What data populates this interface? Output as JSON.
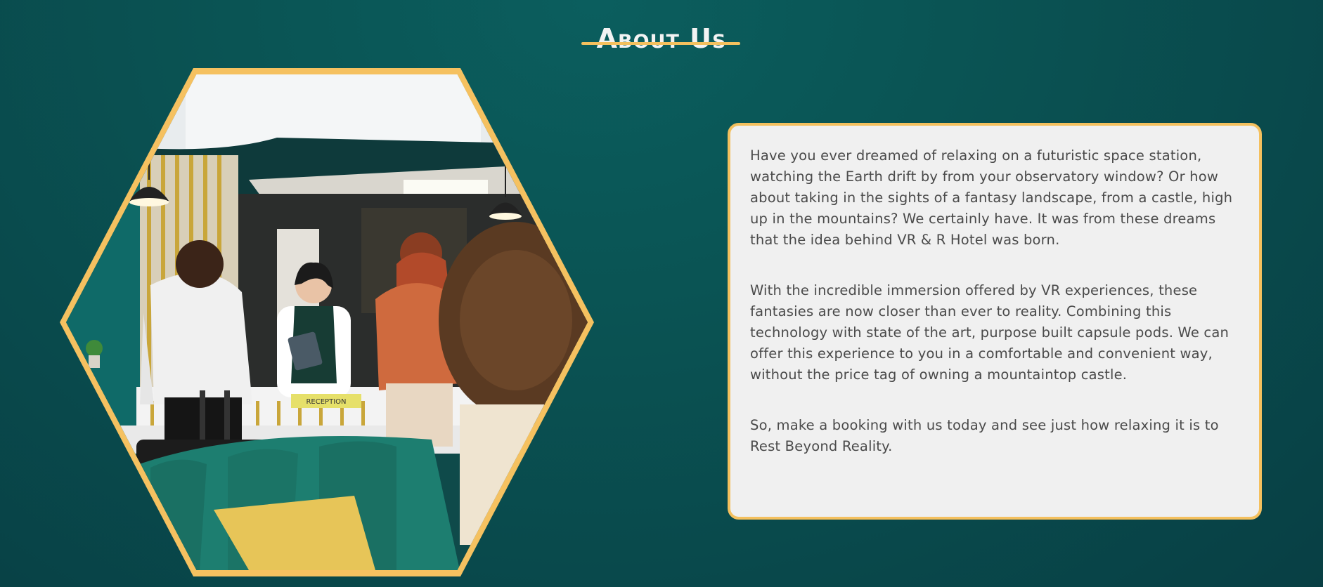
{
  "section": {
    "title": "About Us"
  },
  "image": {
    "alt": "Hotel reception scene",
    "sign_text": "RECEPTION"
  },
  "about": {
    "paragraphs": [
      "Have you ever dreamed of relaxing on a futuristic space station, watching the Earth drift by from your observatory window? Or how about taking in the sights of a fantasy landscape, from a castle, high up in the mountains? We certainly have. It was from these dreams that the idea behind VR & R Hotel was born.",
      "With the incredible immersion offered by VR experiences, these fantasies are now closer than ever to reality. Combining this technology with state of the art, purpose built capsule pods. We can offer this experience to you in a comfortable and convenient way, without the price tag of owning a mountaintop castle.",
      "So, make a booking with us today and see just how relaxing it is to Rest Beyond Reality."
    ]
  },
  "colors": {
    "background": "#0a5454",
    "accent": "#f4c05e",
    "card_background": "#f0f0f0",
    "text": "#4a4a4a",
    "title": "#f3f3f3"
  }
}
